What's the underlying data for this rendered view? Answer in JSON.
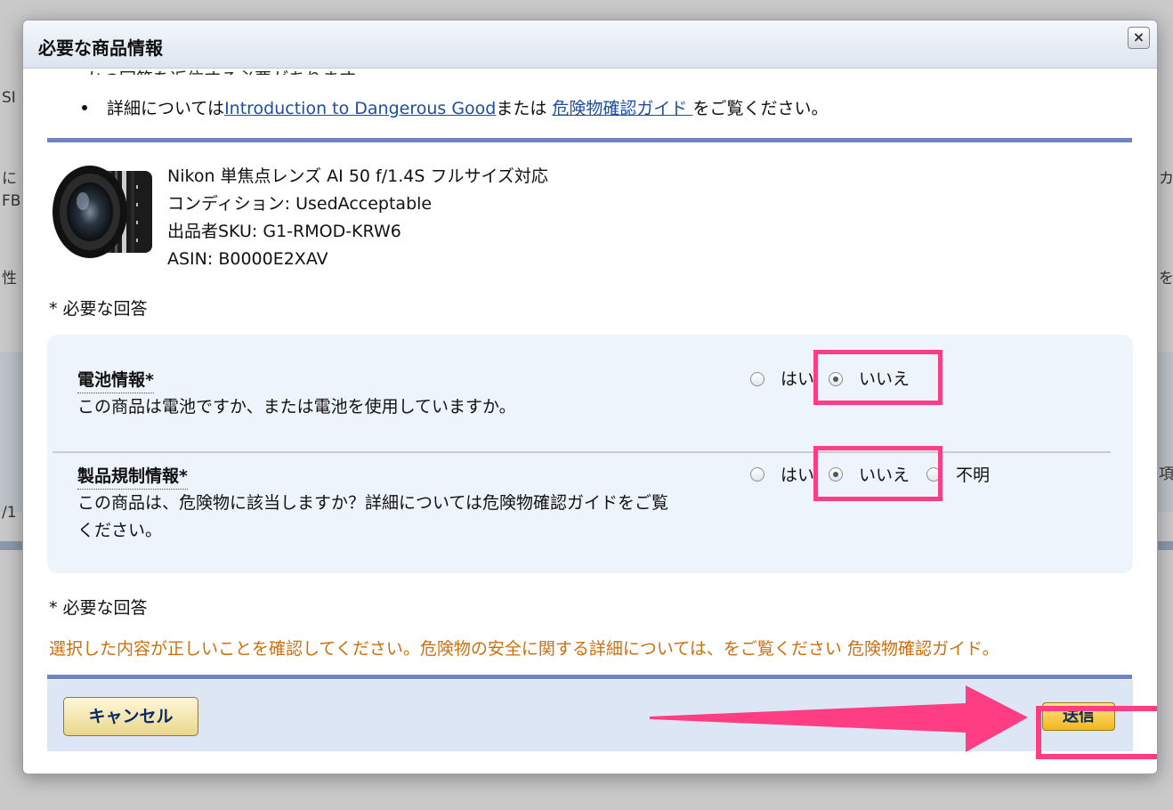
{
  "background": {
    "fragments": [
      "SI",
      "に",
      "FB",
      "性",
      "/1",
      "カ",
      "を",
      "項"
    ]
  },
  "modal": {
    "title": "必要な商品情報",
    "close_label": "×",
    "top_cut_text": "かつ回答を返信する必要があります。",
    "detail": {
      "prefix": "詳細については",
      "link1": "Introduction to Dangerous Good",
      "middle": "または ",
      "link2": "危険物確認ガイド ",
      "suffix": "をご覧ください。"
    },
    "product": {
      "name": "Nikon 単焦点レンズ AI 50 f/1.4S フルサイズ対応",
      "condition": "コンディション: UsedAcceptable",
      "sku": "出品者SKU: G1-RMOD-KRW6",
      "asin": "ASIN: B0000E2XAV"
    },
    "required_note": "* 必要な回答",
    "questions": {
      "battery": {
        "title": "電池情報*",
        "description": "この商品は電池ですか、または電池を使用していますか。",
        "option_yes": "はい",
        "option_no": "いいえ",
        "selected": "いいえ"
      },
      "regulation": {
        "title": "製品規制情報*",
        "description_line1": "この商品は、危険物に該当しますか？詳細については危険物確認ガイドをご覧",
        "description_line2": "ください。",
        "option_yes": "はい",
        "option_no": "いいえ",
        "option_unknown": "不明",
        "selected": "いいえ"
      }
    },
    "required_note_bottom": "* 必要な回答",
    "warning": "選択した内容が正しいことを確認してください。危険物の安全に関する詳細については、をご覧ください 危険物確認ガイド。",
    "footer": {
      "cancel_label": "キャンセル",
      "submit_label": "送信"
    }
  },
  "colors": {
    "highlight": "#ff3d82",
    "link": "#1a4fa3",
    "warning": "#cc6f0c",
    "divider": "#6b85c7"
  }
}
